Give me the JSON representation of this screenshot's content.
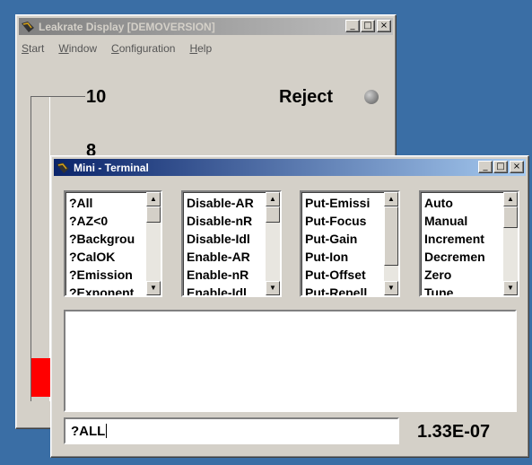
{
  "leakrate_window": {
    "title": "Leakrate Display [DEMOVERSION]",
    "menu": [
      "Start",
      "Window",
      "Configuration",
      "Help"
    ],
    "scale_top": "10",
    "scale_next": "8",
    "status": "Reject",
    "led_color": "#8c8c8c",
    "bar_color": "#ff0000"
  },
  "terminal_window": {
    "title": "Mini - Terminal",
    "lists": [
      {
        "items": [
          "?All",
          "?AZ<0",
          "?Backgrou",
          "?CalOK",
          "?Emission",
          "?Exponent"
        ]
      },
      {
        "items": [
          "Disable-AR",
          "Disable-nR",
          "Disable-Idl",
          "Enable-AR",
          "Enable-nR",
          "Enable-Idl"
        ]
      },
      {
        "items": [
          "Put-Emissi",
          "Put-Focus",
          "Put-Gain",
          "Put-Ion",
          "Put-Offset",
          "Put-Repell"
        ]
      },
      {
        "items": [
          "Auto",
          "Manual",
          "Increment",
          "Decremen",
          "Zero",
          "Tune"
        ]
      }
    ],
    "command_value": "?ALL",
    "reading": "1.33E-07"
  },
  "controls": {
    "minimize": "_",
    "maximize": "□",
    "close": "×"
  }
}
